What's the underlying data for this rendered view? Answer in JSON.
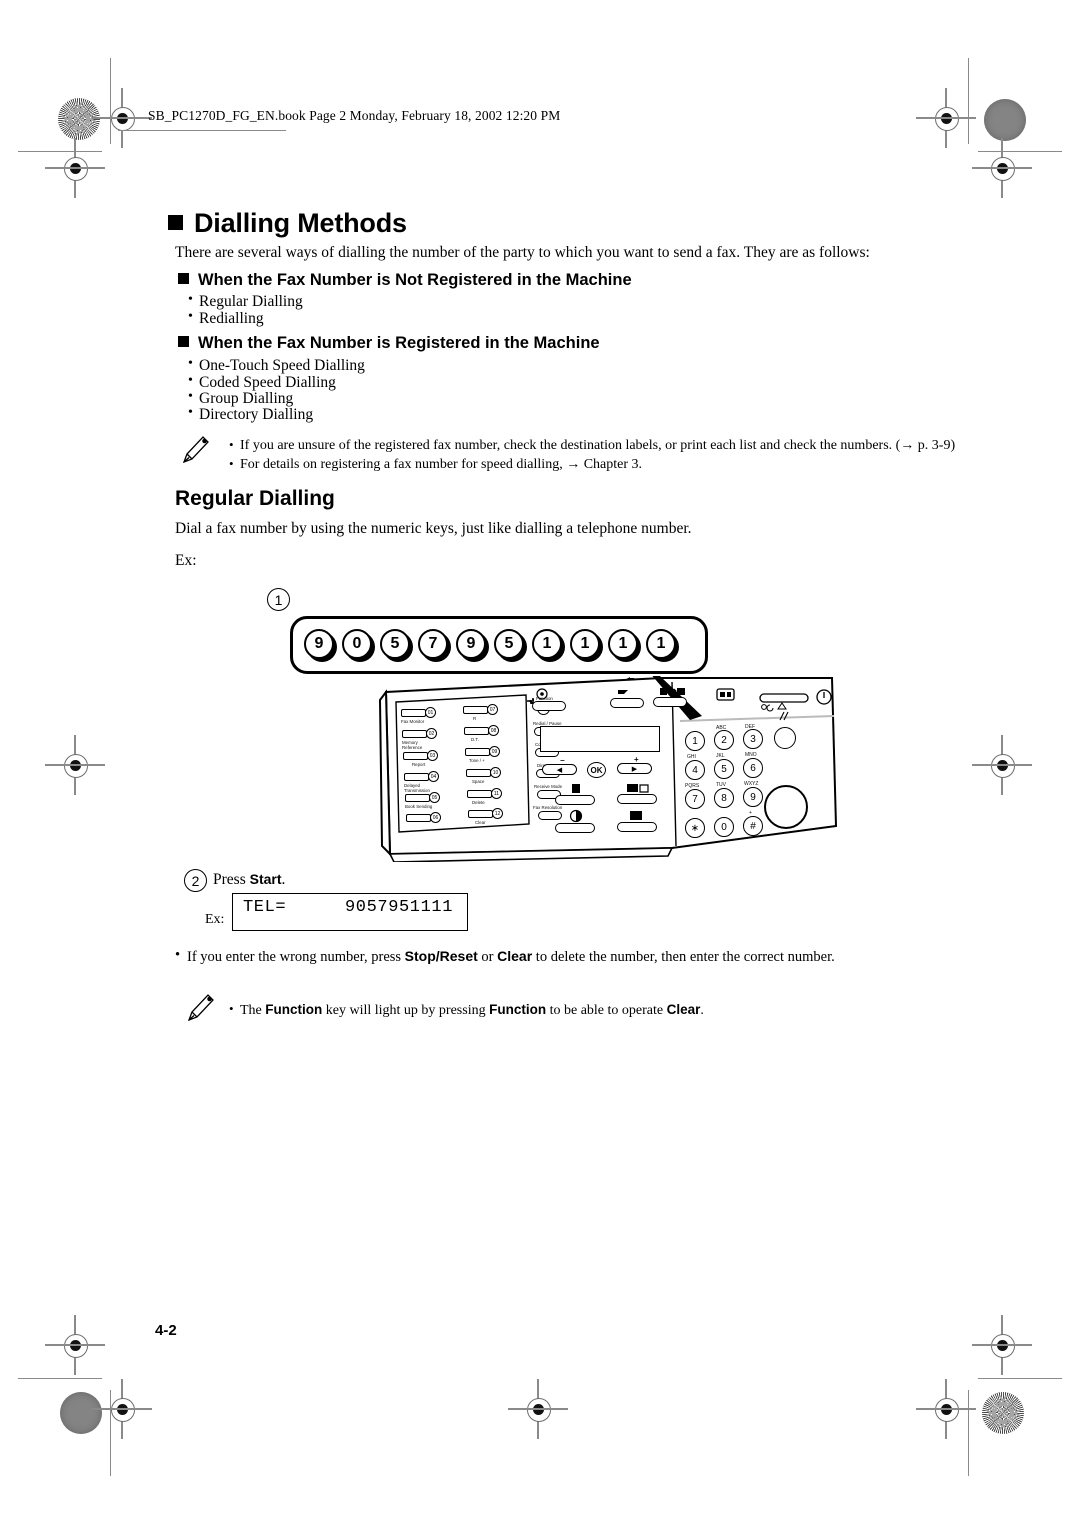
{
  "header": {
    "file_line": "SB_PC1270D_FG_EN.book  Page 2  Monday, February 18, 2002  12:20 PM"
  },
  "section": {
    "title": "Dialling Methods",
    "intro": "There are several ways of dialling the number of the party to which you want to send a fax. They are as follows:",
    "sub1_title": "When the Fax Number is Not Registered in the Machine",
    "sub1_items": [
      "Regular Dialling",
      "Redialling"
    ],
    "sub2_title": "When the Fax Number is Registered in the Machine",
    "sub2_items": [
      "One-Touch Speed Dialling",
      "Coded Speed Dialling",
      "Group Dialling",
      "Directory Dialling"
    ]
  },
  "note1": {
    "line1": "If you are unsure of the registered fax number, check the destination labels, or print each list and check the numbers. (→ p. 3-9)",
    "line2": "For details on registering a fax number for speed dialling, → Chapter 3."
  },
  "regular": {
    "title": "Regular Dialling",
    "desc": "Dial a fax number by using the numeric keys, just like dialling a telephone number.",
    "ex_label": "Ex:"
  },
  "step1": {
    "number": "1",
    "digits": [
      "9",
      "0",
      "5",
      "7",
      "9",
      "5",
      "1",
      "1",
      "1",
      "1"
    ]
  },
  "step2": {
    "number": "2",
    "text_before": "Press ",
    "bold": "Start",
    "text_after": ".",
    "ex_label": "Ex:",
    "lcd_left": "TEL=",
    "lcd_right": "9057951111"
  },
  "bullet_note": {
    "p1": "If you enter the wrong number, press ",
    "b1": "Stop/Reset",
    "p2": " or ",
    "b2": "Clear",
    "p3": " to delete the number, then enter the correct number."
  },
  "note2": {
    "p1": "The ",
    "b1": "Function",
    "p2": " key will light up by pressing ",
    "b2": "Function",
    "p3": " to be able to operate ",
    "b3": "Clear",
    "p4": "."
  },
  "panel": {
    "one_touch_left": [
      {
        "num": "01",
        "label": "Fax Monitor"
      },
      {
        "num": "02",
        "label": "Memory\nReference"
      },
      {
        "num": "03",
        "label": "Report"
      },
      {
        "num": "04",
        "label": "Delayed\nTransmission"
      },
      {
        "num": "05",
        "label": "Book Sending"
      },
      {
        "num": "06",
        "label": ""
      }
    ],
    "one_touch_right": [
      {
        "num": "07",
        "label": "R"
      },
      {
        "num": "08",
        "label": "D.T."
      },
      {
        "num": "09",
        "label": "Tone / +"
      },
      {
        "num": "10",
        "label": "Space"
      },
      {
        "num": "11",
        "label": "Delete"
      },
      {
        "num": "12",
        "label": "Clear"
      }
    ],
    "function_keys": [
      "Function",
      "Redial / Pause",
      "Coded Dial",
      "Directory",
      "Receive Mode",
      "Fax Resolution"
    ],
    "keypad": [
      {
        "digit": "1",
        "letters": ""
      },
      {
        "digit": "2",
        "letters": "ABC"
      },
      {
        "digit": "3",
        "letters": "DEF"
      },
      {
        "digit": "4",
        "letters": "GHI"
      },
      {
        "digit": "5",
        "letters": "JKL"
      },
      {
        "digit": "6",
        "letters": "MNO"
      },
      {
        "digit": "7",
        "letters": "PQRS"
      },
      {
        "digit": "8",
        "letters": "TUV"
      },
      {
        "digit": "9",
        "letters": "WXYZ"
      },
      {
        "digit": "∗",
        "letters": ""
      },
      {
        "digit": "0",
        "letters": ""
      },
      {
        "digit": "#",
        "letters": "+"
      }
    ],
    "nav": {
      "minus": "−",
      "plus": "+",
      "left": "◀",
      "right": "▶",
      "ok": "OK"
    }
  },
  "footer": {
    "page": "4-2"
  }
}
